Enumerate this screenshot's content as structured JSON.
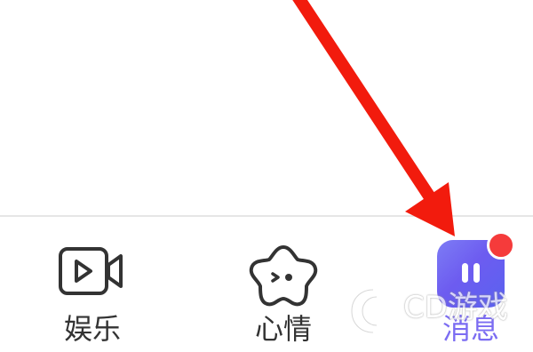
{
  "tabbar": {
    "tabs": [
      {
        "id": "entertainment",
        "label": "娱乐",
        "icon": "video-camera-icon"
      },
      {
        "id": "mood",
        "label": "心情",
        "icon": "star-face-icon"
      },
      {
        "id": "messages",
        "label": "消息",
        "icon": "message-app-icon",
        "has_badge": true
      }
    ]
  },
  "watermark": {
    "text": "CD游戏"
  },
  "colors": {
    "accent_purple": "#6d5cf0",
    "badge_red": "#f53b3b",
    "arrow_red": "#f21b0d",
    "icon_stroke": "#333333"
  }
}
